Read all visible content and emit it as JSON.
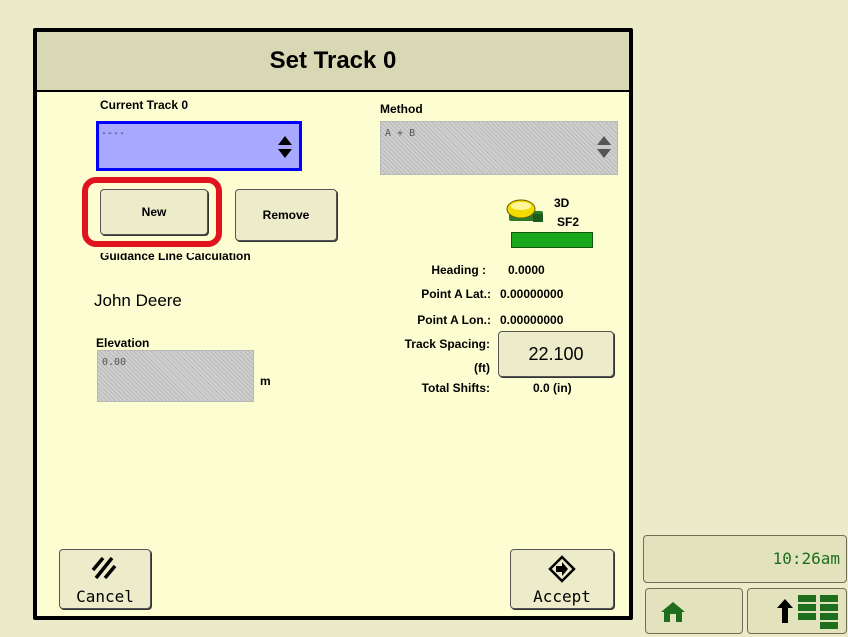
{
  "dialog": {
    "title": "Set Track 0",
    "current_track_label": "Current Track 0",
    "current_track_value": "----",
    "new_label": "New",
    "remove_label": "Remove",
    "guidance_label": "Guidance Line Calculation",
    "guidance_value": "John Deere",
    "elevation_label": "Elevation",
    "elevation_value": "0.00",
    "elevation_unit": "m",
    "method_label": "Method",
    "method_value": "A + B",
    "gps_mode": "3D",
    "gps_signal": "SF2",
    "heading_label": "Heading :",
    "heading_value": "0.0000",
    "point_a_lat_label": "Point A Lat.:",
    "point_a_lat_value": "0.00000000",
    "point_a_lon_label": "Point A Lon.:",
    "point_a_lon_value": "0.00000000",
    "track_spacing_label": "Track Spacing:",
    "track_spacing_unit": "(ft)",
    "track_spacing_value": "22.100",
    "total_shifts_label": "Total Shifts:",
    "total_shifts_value": "0.0 (in)",
    "cancel_label": "Cancel",
    "accept_label": "Accept"
  },
  "sidebar": {
    "clock": "10:26am"
  },
  "colors": {
    "background": "#ecebc9",
    "panel": "#fdfdd2",
    "selected_field": "#a8a8ff",
    "selected_border": "#0000ff",
    "highlight_ring": "#e0141e",
    "gps_bar": "#19a819",
    "clock_text": "#1e6e1e"
  },
  "icons": [
    "updown-arrows-icon",
    "gps-receiver-icon",
    "cancel-icon",
    "accept-icon",
    "home-icon",
    "up-arrow-icon",
    "menu-grid-icon"
  ]
}
